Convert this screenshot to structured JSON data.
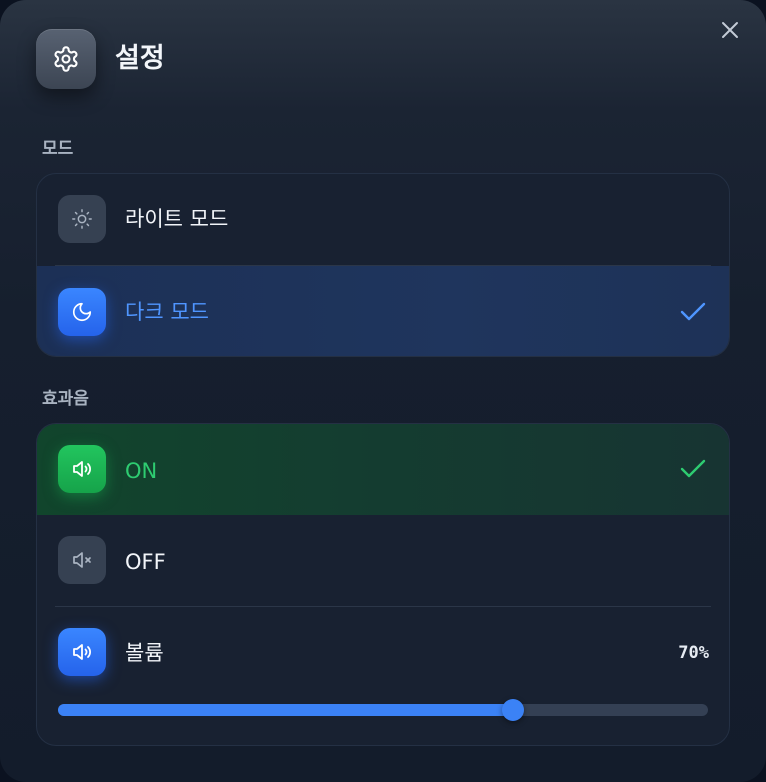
{
  "header": {
    "title": "설정",
    "icon": "gear-icon"
  },
  "close": {
    "icon": "close-icon"
  },
  "mode_section": {
    "label": "모드",
    "options": [
      {
        "label": "라이트 모드",
        "icon": "sun-icon",
        "selected": false
      },
      {
        "label": "다크 모드",
        "icon": "moon-icon",
        "selected": true
      }
    ]
  },
  "sound_section": {
    "label": "효과음",
    "options": [
      {
        "label": "ON",
        "icon": "speaker-on-icon",
        "selected": true
      },
      {
        "label": "OFF",
        "icon": "speaker-mute-icon",
        "selected": false
      }
    ],
    "volume": {
      "label": "볼륨",
      "icon": "speaker-on-icon",
      "value_text": "70%",
      "value": 0.7
    }
  },
  "colors": {
    "accent_blue": "#3b82f6",
    "accent_green": "#22c55e",
    "panel_bg": "#161f2e"
  }
}
